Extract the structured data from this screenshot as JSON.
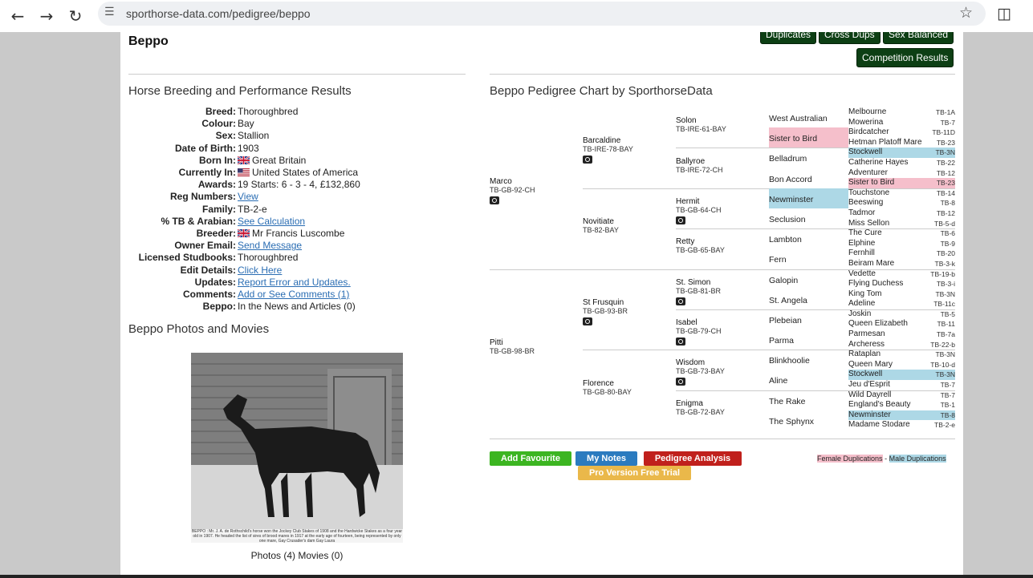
{
  "browser": {
    "url": "sporthorse-data.com/pedigree/beppo"
  },
  "header": {
    "title": "Beppo",
    "buttons": [
      "Duplicates",
      "Cross Dups",
      "Sex Balanced",
      "Competition Results"
    ]
  },
  "left": {
    "section_title": "Horse Breeding and Performance Results",
    "details": [
      {
        "label": "Breed:",
        "value": "Thoroughbred"
      },
      {
        "label": "Colour:",
        "value": "Bay"
      },
      {
        "label": "Sex:",
        "value": "Stallion"
      },
      {
        "label": "Date of Birth:",
        "value": "1903"
      },
      {
        "label": "Born In:",
        "value": "Great Britain",
        "flag": "uk"
      },
      {
        "label": "Currently In:",
        "value": "United States of America",
        "flag": "us"
      },
      {
        "label": "Awards:",
        "value": "19 Starts: 6 - 3 - 4, £132,860"
      },
      {
        "label": "Reg Numbers:",
        "value": "View",
        "link": true
      },
      {
        "label": "Family:",
        "value": "TB-2-e"
      },
      {
        "label": "% TB & Arabian:",
        "value": "See Calculation",
        "link": true
      },
      {
        "label": "Breeder:",
        "value": "Mr Francis Luscombe",
        "flag": "uk"
      },
      {
        "label": "Owner Email:",
        "value": "Send Message",
        "link": true
      },
      {
        "label": "Licensed Studbooks:",
        "value": "Thoroughbred"
      },
      {
        "label": "Edit Details:",
        "value": "Click Here",
        "link": true
      },
      {
        "label": "Updates:",
        "value": "Report Error and Updates.",
        "link": true
      },
      {
        "label": "Comments:",
        "value": "Add or See Comments (1)",
        "link": true
      },
      {
        "label": "Beppo:",
        "value": "In the News and Articles (0)"
      }
    ],
    "photos_title": "Beppo Photos and Movies",
    "photo_caption": "BEPPO : Mr. J. A. de Rothschild's horse won the Jockey Club Stakes of 1908 and the Hardwicke Stakes as a four year old in 1907. He headed the list of sires of brood mares in 1917 at the early age of fourteen, being represented by only one mare, Gay Crusader's dam Gay Laura",
    "photo_count": "Photos (4) Movies (0)"
  },
  "pedigree": {
    "title": "Beppo Pedigree Chart by SporthorseData",
    "gen1": [
      {
        "name": "Marco",
        "reg": "TB-GB-92-CH",
        "photo": true
      },
      {
        "name": "Pitti",
        "reg": "TB-GB-98-BR",
        "photo": false
      }
    ],
    "gen2": [
      {
        "name": "Barcaldine",
        "reg": "TB-IRE-78-BAY",
        "photo": true
      },
      {
        "name": "Novitiate",
        "reg": "TB-82-BAY",
        "photo": false
      },
      {
        "name": "St Frusquin",
        "reg": "TB-GB-93-BR",
        "photo": true
      },
      {
        "name": "Florence",
        "reg": "TB-GB-80-BAY",
        "photo": false
      }
    ],
    "gen3": [
      {
        "name": "Solon",
        "reg": "TB-IRE-61-BAY",
        "photo": false
      },
      {
        "name": "Ballyroe",
        "reg": "TB-IRE-72-CH",
        "photo": false
      },
      {
        "name": "Hermit",
        "reg": "TB-GB-64-CH",
        "photo": true
      },
      {
        "name": "Retty",
        "reg": "TB-GB-65-BAY",
        "photo": false
      },
      {
        "name": "St. Simon",
        "reg": "TB-GB-81-BR",
        "photo": true
      },
      {
        "name": "Isabel",
        "reg": "TB-GB-79-CH",
        "photo": true
      },
      {
        "name": "Wisdom",
        "reg": "TB-GB-73-BAY",
        "photo": true
      },
      {
        "name": "Enigma",
        "reg": "TB-GB-72-BAY",
        "photo": false
      }
    ],
    "gen4": [
      {
        "name": "West Australian",
        "hl": ""
      },
      {
        "name": "Sister to Bird",
        "hl": "pink"
      },
      {
        "name": "Belladrum",
        "hl": ""
      },
      {
        "name": "Bon Accord",
        "hl": ""
      },
      {
        "name": "Newminster",
        "hl": "blue"
      },
      {
        "name": "Seclusion",
        "hl": ""
      },
      {
        "name": "Lambton",
        "hl": ""
      },
      {
        "name": "Fern",
        "hl": ""
      },
      {
        "name": "Galopin",
        "hl": ""
      },
      {
        "name": "St. Angela",
        "hl": ""
      },
      {
        "name": "Plebeian",
        "hl": ""
      },
      {
        "name": "Parma",
        "hl": ""
      },
      {
        "name": "Blinkhoolie",
        "hl": ""
      },
      {
        "name": "Aline",
        "hl": ""
      },
      {
        "name": "The Rake",
        "hl": ""
      },
      {
        "name": "The Sphynx",
        "hl": ""
      }
    ],
    "gen5": [
      {
        "name": "Melbourne",
        "code": "TB-1A",
        "hl": ""
      },
      {
        "name": "Mowerina",
        "code": "TB-7",
        "hl": ""
      },
      {
        "name": "Birdcatcher",
        "code": "TB-11D",
        "hl": ""
      },
      {
        "name": "Hetman Platoff Mare",
        "code": "TB-23",
        "hl": ""
      },
      {
        "name": "Stockwell",
        "code": "TB-3N",
        "hl": "blue"
      },
      {
        "name": "Catherine Hayes",
        "code": "TB-22",
        "hl": ""
      },
      {
        "name": "Adventurer",
        "code": "TB-12",
        "hl": ""
      },
      {
        "name": "Sister to Bird",
        "code": "TB-23",
        "hl": "pink"
      },
      {
        "name": "Touchstone",
        "code": "TB-14",
        "hl": ""
      },
      {
        "name": "Beeswing",
        "code": "TB-8",
        "hl": ""
      },
      {
        "name": "Tadmor",
        "code": "TB-12",
        "hl": ""
      },
      {
        "name": "Miss Sellon",
        "code": "TB-5-d",
        "hl": ""
      },
      {
        "name": "The Cure",
        "code": "TB-6",
        "hl": ""
      },
      {
        "name": "Elphine",
        "code": "TB-9",
        "hl": ""
      },
      {
        "name": "Fernhill",
        "code": "TB-20",
        "hl": ""
      },
      {
        "name": "Beiram Mare",
        "code": "TB-3-k",
        "hl": ""
      },
      {
        "name": "Vedette",
        "code": "TB-19-b",
        "hl": ""
      },
      {
        "name": "Flying Duchess",
        "code": "TB-3-i",
        "hl": ""
      },
      {
        "name": "King Tom",
        "code": "TB-3N",
        "hl": ""
      },
      {
        "name": "Adeline",
        "code": "TB-11c",
        "hl": ""
      },
      {
        "name": "Joskin",
        "code": "TB-5",
        "hl": ""
      },
      {
        "name": "Queen Elizabeth",
        "code": "TB-11",
        "hl": ""
      },
      {
        "name": "Parmesan",
        "code": "TB-7a",
        "hl": ""
      },
      {
        "name": "Archeress",
        "code": "TB-22-b",
        "hl": ""
      },
      {
        "name": "Rataplan",
        "code": "TB-3N",
        "hl": ""
      },
      {
        "name": "Queen Mary",
        "code": "TB-10-d",
        "hl": ""
      },
      {
        "name": "Stockwell",
        "code": "TB-3N",
        "hl": "blue"
      },
      {
        "name": "Jeu d'Esprit",
        "code": "TB-7",
        "hl": ""
      },
      {
        "name": "Wild Dayrell",
        "code": "TB-7",
        "hl": ""
      },
      {
        "name": "England's Beauty",
        "code": "TB-1",
        "hl": ""
      },
      {
        "name": "Newminster",
        "code": "TB-8",
        "hl": "blue"
      },
      {
        "name": "Madame Stodare",
        "code": "TB-2-e",
        "hl": ""
      }
    ]
  },
  "actions": {
    "add_favourite": "Add Favourite",
    "my_notes": "My Notes",
    "pedigree_analysis": "Pedigree Analysis",
    "pro_trial": "Pro Version Free Trial"
  },
  "legend": {
    "female": "Female Duplications",
    "sep": "-",
    "male": "Male Duplications"
  },
  "colors": {
    "green_dark": "#0d3f14",
    "btn_green": "#3cb521",
    "btn_blue": "#2b7bbf",
    "btn_red": "#c0201c",
    "btn_gold": "#eab84a",
    "pink": "#f5bfcb",
    "blue": "#add8e6",
    "link": "#2a6db3"
  }
}
